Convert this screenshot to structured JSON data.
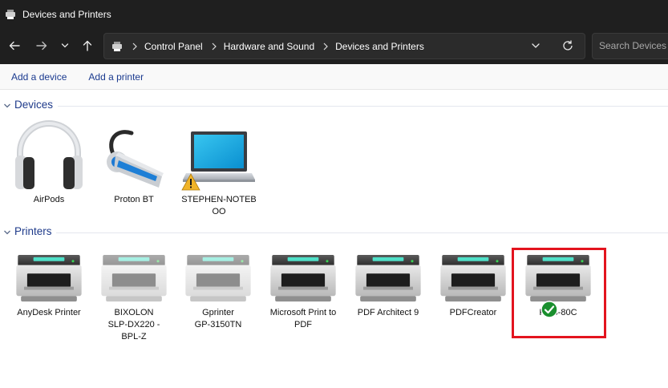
{
  "window": {
    "title": "Devices and Printers"
  },
  "nav": {
    "breadcrumbs": [
      "Control Panel",
      "Hardware and Sound",
      "Devices and Printers"
    ],
    "search_placeholder": "Search Devices and Printers"
  },
  "commands": {
    "add_device": "Add a device",
    "add_printer": "Add a printer"
  },
  "groups": {
    "devices": {
      "label": "Devices",
      "items": [
        {
          "name": "AirPods",
          "icon": "headphones-icon"
        },
        {
          "name": "Proton BT",
          "icon": "bluetooth-headset-icon"
        },
        {
          "line1": "STEPHEN-NOTEB",
          "line2": "OO",
          "icon": "laptop-icon",
          "warning": true
        }
      ]
    },
    "printers": {
      "label": "Printers",
      "items": [
        {
          "line1": "AnyDesk Printer",
          "line2": "",
          "line3": "",
          "icon": "printer-icon",
          "dimmed": false
        },
        {
          "line1": "BIXOLON",
          "line2": "SLP-DX220 -",
          "line3": "BPL-Z",
          "icon": "printer-icon",
          "dimmed": true
        },
        {
          "line1": "Gprinter",
          "line2": "GP-3150TN",
          "line3": "",
          "icon": "printer-icon",
          "dimmed": true
        },
        {
          "line1": "Microsoft Print to",
          "line2": "PDF",
          "line3": "",
          "icon": "printer-icon",
          "dimmed": false
        },
        {
          "line1": "PDF Architect 9",
          "line2": "",
          "line3": "",
          "icon": "printer-icon",
          "dimmed": false
        },
        {
          "line1": "PDFCreator",
          "line2": "",
          "line3": "",
          "icon": "printer-icon",
          "dimmed": false
        },
        {
          "line1": "POS-80C",
          "line2": "",
          "line3": "",
          "icon": "printer-icon",
          "dimmed": false,
          "default": true,
          "highlighted": true
        }
      ]
    }
  },
  "colors": {
    "titlebar": "#1f1f1f",
    "link": "#1a3a8f",
    "group_header": "#1e3a8a",
    "highlight": "#e3141e",
    "default_check": "#1a8f2e"
  }
}
